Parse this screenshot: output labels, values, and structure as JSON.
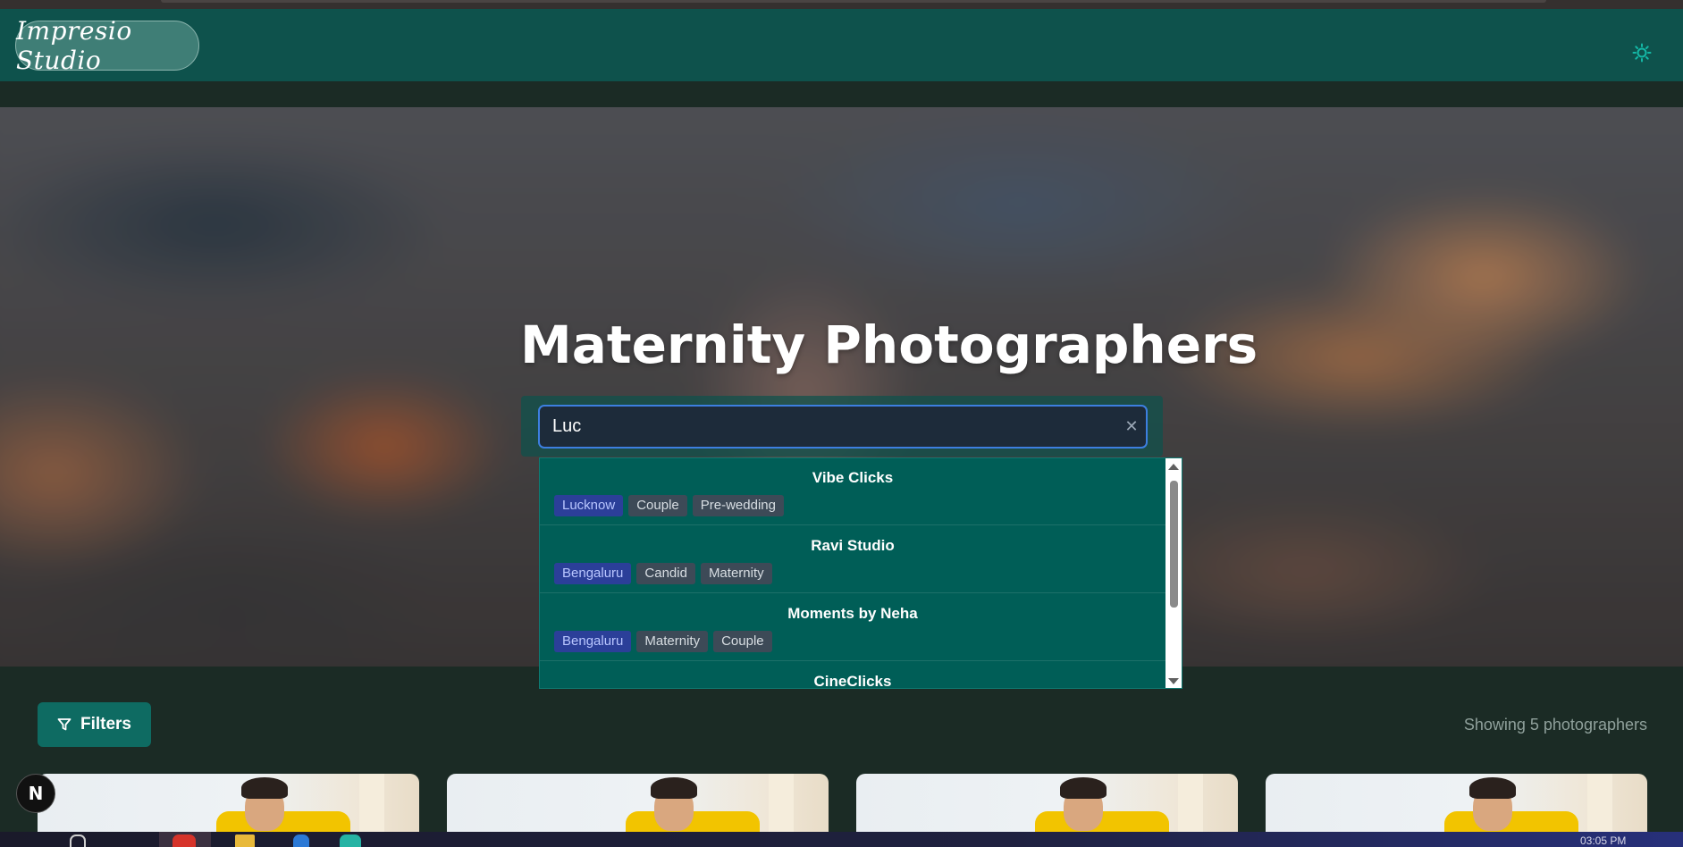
{
  "app": {
    "logo_text": "Impresio Studio"
  },
  "hero": {
    "title": "Maternity Photographers"
  },
  "search": {
    "value": "Luc",
    "clear_icon": "close-icon",
    "results": [
      {
        "name": "Vibe Clicks",
        "city": "Lucknow",
        "tags": [
          "Couple",
          "Pre-wedding"
        ]
      },
      {
        "name": "Ravi Studio",
        "city": "Bengaluru",
        "tags": [
          "Candid",
          "Maternity"
        ]
      },
      {
        "name": "Moments by Neha",
        "city": "Bengaluru",
        "tags": [
          "Maternity",
          "Couple"
        ]
      },
      {
        "name": "CineClicks"
      }
    ]
  },
  "toolbar": {
    "filters_label": "Filters",
    "filter_icon": "funnel-icon",
    "result_count": "Showing 5 photographers"
  },
  "floating": {
    "badge_text": "N"
  },
  "taskbar": {
    "time": "03:05 PM"
  },
  "colors": {
    "navbar": "#0e524c",
    "accent": "#0e6b62",
    "dropdown": "#005e57",
    "city_tag": "#2b3f99",
    "input_border": "#3d7fe0",
    "page_bg": "#1b2b25"
  }
}
